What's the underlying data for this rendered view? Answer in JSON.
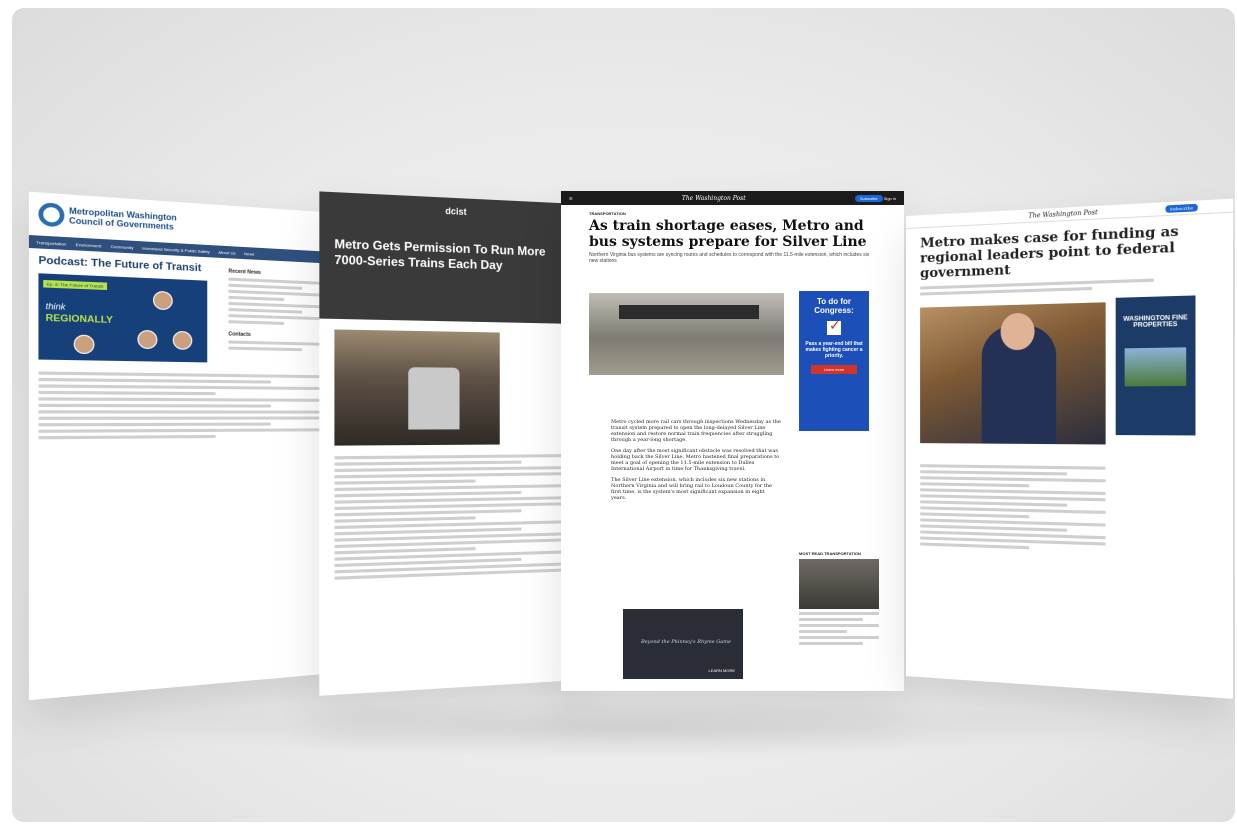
{
  "mwcog": {
    "org_line1": "Metropolitan Washington",
    "org_line2": "Council of Governments",
    "nav": [
      "Transportation",
      "Environment",
      "Community",
      "Homeland Security & Public Safety",
      "About Us",
      "News"
    ],
    "page_title": "Podcast: The Future of Transit",
    "banner_episode": "Ep. 6: The Future of Transit",
    "banner_think": "think",
    "banner_regionally": "REGIONALLY",
    "sidebar_heading": "Recent News",
    "contacts_heading": "Contacts"
  },
  "dcist": {
    "brand": "dcist",
    "headline": "Metro Gets Permission To Run More 7000-Series Trains Each Day"
  },
  "wapo_center": {
    "masthead": "The Washington Post",
    "subscribe": "Subscribe",
    "sign_in": "Sign in",
    "kicker": "TRANSPORTATION",
    "headline": "As train shortage eases, Metro and bus systems prepare for Silver Line",
    "dek": "Northern Virginia bus systems are syncing routes and schedules to correspond with the 11.5-mile extension, which includes six new stations",
    "para1": "Metro cycled more rail cars through inspections Wednesday as the transit system prepared to open the long-delayed Silver Line extension and restore normal train frequencies after struggling through a year-long shortage.",
    "para2": "One day after the most significant obstacle was resolved that was holding back the Silver Line, Metro hastened final preparations to meet a goal of opening the 11.5-mile extension to Dulles International Airport in time for Thanksgiving travel.",
    "para3": "The Silver Line extension, which includes six new stations in Northern Virginia and will bring rail to Loudoun County for the first time, is the system's most significant expansion in eight years.",
    "ad_title": "To do for Congress:",
    "ad_body": "Pass a year-end bill that makes fighting cancer a priority.",
    "ad_button": "Learn more",
    "most_read": "MOST READ TRANSPORTATION",
    "promo_title": "Beyond the Phinney's Rhyme Game",
    "promo_button": "LEARN MORE"
  },
  "wapo_right": {
    "masthead": "The Washington Post",
    "subscribe": "Subscribe",
    "headline": "Metro makes case for funding as regional leaders point to federal government",
    "ad_brand": "WASHINGTON FINE PROPERTIES"
  }
}
